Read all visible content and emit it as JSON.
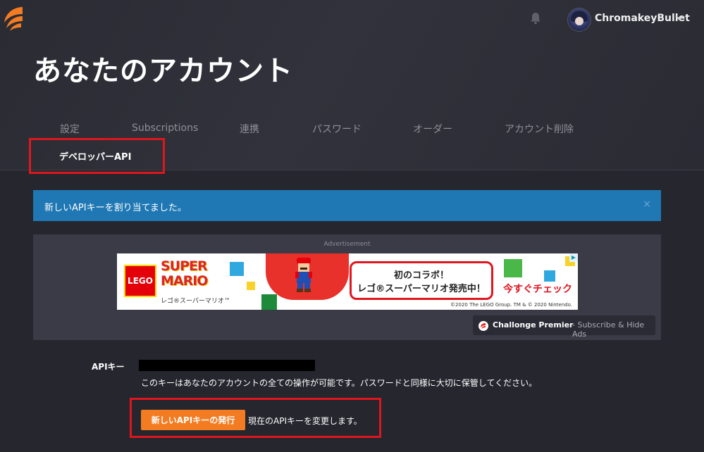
{
  "header": {
    "logo": "challonge-logo",
    "bell_icon": "bell-icon",
    "username": "ChromakeyBullet",
    "menu_icon": "chevron-down-icon"
  },
  "page": {
    "title": "あなたのアカウント"
  },
  "tabs": [
    {
      "label": "設定"
    },
    {
      "label": "Subscriptions"
    },
    {
      "label": "連携"
    },
    {
      "label": "パスワード"
    },
    {
      "label": "オーダー"
    },
    {
      "label": "アカウント削除"
    },
    {
      "label": "デベロッパーAPI",
      "active": true
    }
  ],
  "alert": {
    "message": "新しいAPIキーを割り当てました。",
    "close": "×",
    "color": "#1f78b4"
  },
  "ad": {
    "label": "Advertisement",
    "banner": {
      "logo": "LEGO",
      "brand_line1": "SUPER",
      "brand_line2": "MARIO",
      "brand_sub": "レゴ®スーパーマリオ™",
      "promo_line1": "初のコラボ！",
      "promo_line2": "レゴ®スーパーマリオ発売中！",
      "cta": "今すぐチェック",
      "copyright": "©2020 The LEGO Group. TM & © 2020 Nintendo."
    },
    "premier_brand": "Challonge Premier",
    "premier_sub": "- Subscribe & Hide Ads"
  },
  "api": {
    "label": "APIキー",
    "help": "このキーはあなたのアカウントの全ての操作が可能です。パスワードと同様に大切に保管してください。",
    "button": "新しいAPIキーの発行",
    "button_desc": "現在のAPIキーを変更します。"
  },
  "colors": {
    "accent": "#f37c22",
    "highlight": "#e0161e",
    "background": "#25262e"
  }
}
